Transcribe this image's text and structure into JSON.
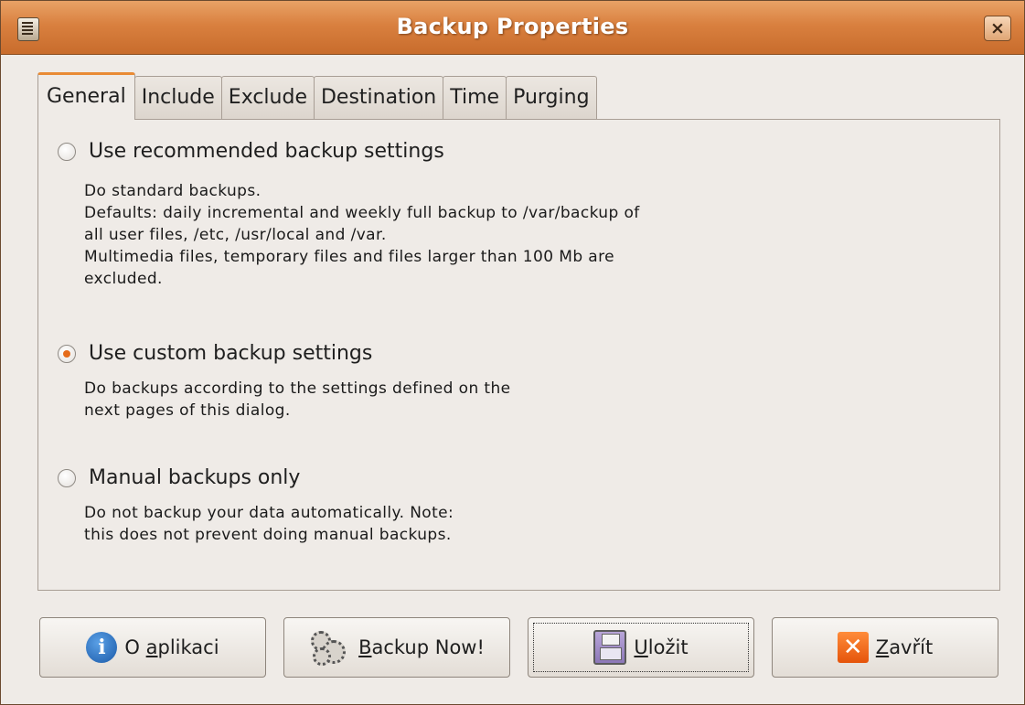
{
  "window": {
    "title": "Backup Properties",
    "close_symbol": "×"
  },
  "tabs": [
    {
      "label": "General",
      "active": true
    },
    {
      "label": "Include",
      "active": false
    },
    {
      "label": "Exclude",
      "active": false
    },
    {
      "label": "Destination",
      "active": false
    },
    {
      "label": "Time",
      "active": false
    },
    {
      "label": "Purging",
      "active": false
    }
  ],
  "options": {
    "recommended": {
      "label": "Use recommended backup settings",
      "checked": false,
      "description": "Do standard backups.\nDefaults: daily incremental and weekly full backup to /var/backup of\nall user files, /etc, /usr/local and /var.\nMultimedia files, temporary files and files larger than 100 Mb are\nexcluded."
    },
    "custom": {
      "label": "Use custom backup settings",
      "checked": true,
      "description": "Do backups according to the settings defined on the\nnext pages of this dialog."
    },
    "manual": {
      "label": "Manual backups only",
      "checked": false,
      "description": "Do not backup your data automatically. Note:\nthis does not prevent doing manual backups."
    }
  },
  "buttons": {
    "about": {
      "prefix": "O ",
      "mnemonic": "a",
      "rest": "plikaci",
      "icon": "info-icon"
    },
    "backup_now": {
      "prefix": "",
      "mnemonic": "B",
      "rest": "ackup Now!",
      "icon": "gears-icon"
    },
    "save": {
      "prefix": "",
      "mnemonic": "U",
      "rest": "ložit",
      "icon": "floppy-disk-icon"
    },
    "close": {
      "prefix": "",
      "mnemonic": "Z",
      "rest": "avřít",
      "icon": "close-x-icon"
    }
  },
  "colors": {
    "titlebar": "#d9803f",
    "accent": "#e98b35",
    "window_bg": "#efebe7"
  }
}
